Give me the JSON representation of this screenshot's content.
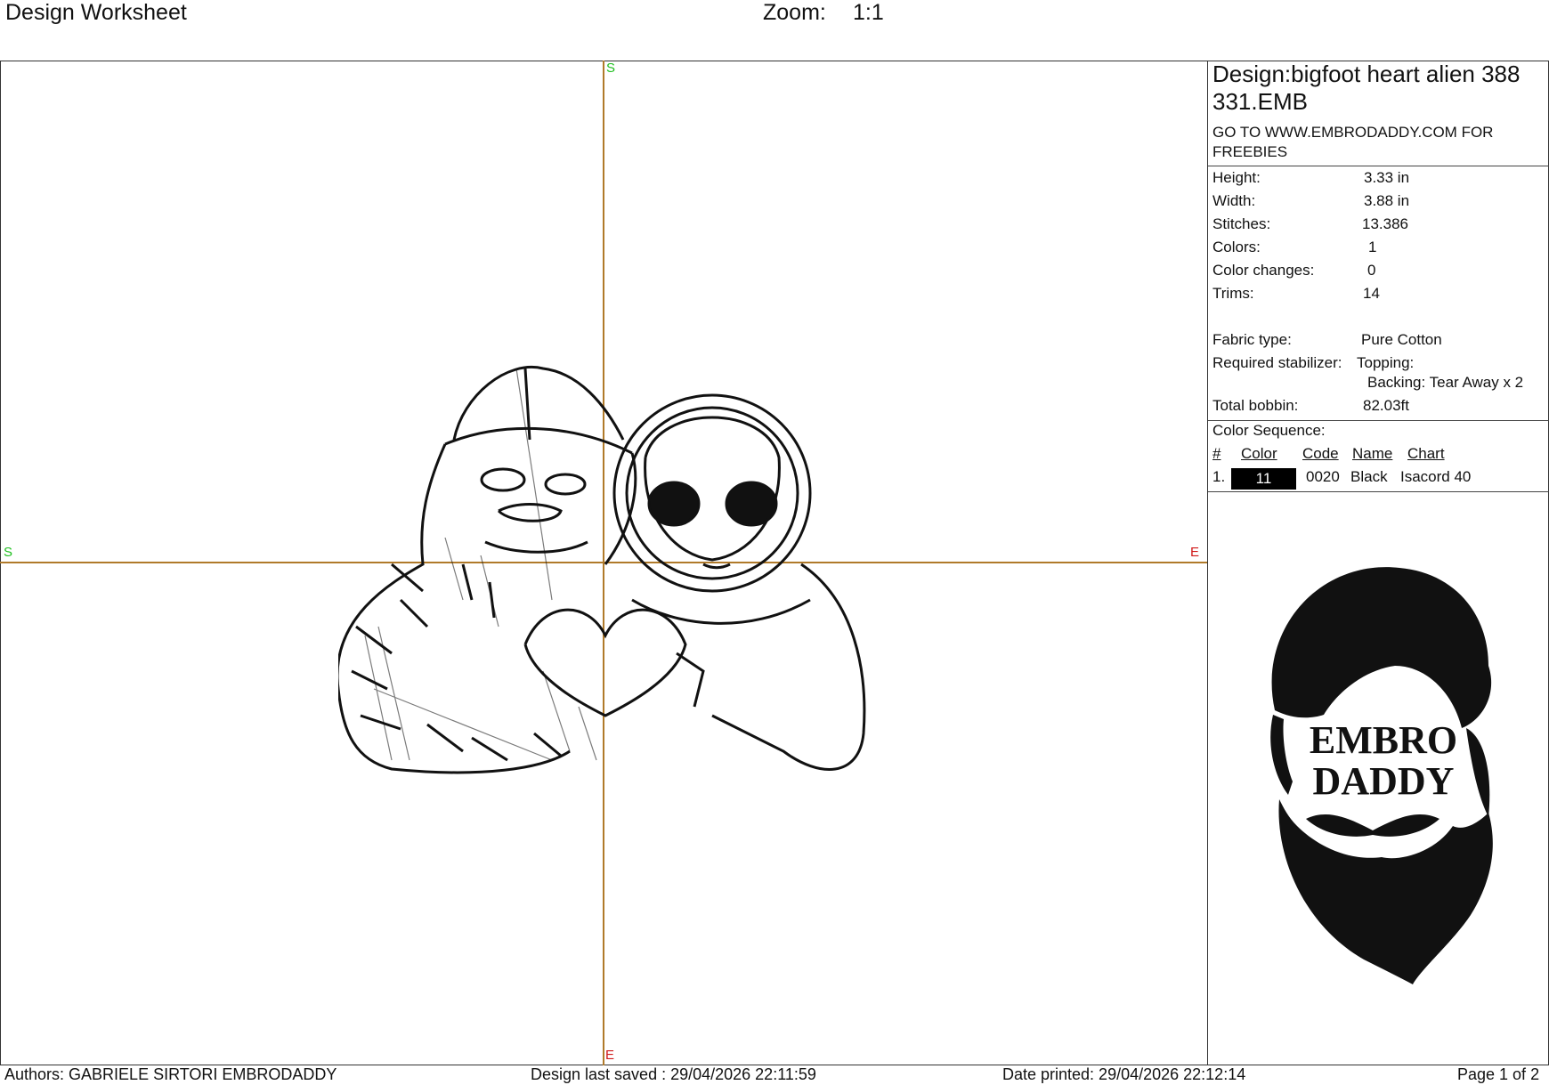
{
  "header": {
    "title": "Design Worksheet",
    "zoom_label": "Zoom:",
    "zoom_value": "1:1"
  },
  "canvas": {
    "markers": {
      "top": "S",
      "left": "S",
      "right": "E",
      "bottom": "E"
    },
    "colors": {
      "axis": "#b07a2a",
      "start_marker": "#20c020",
      "end_marker": "#d01818",
      "stitch": "#111111"
    }
  },
  "info": {
    "design_name": "Design:bigfoot heart alien 388 331.EMB",
    "promo": "GO TO WWW.EMBRODADDY.COM FOR FREEBIES",
    "height_label": "Height:",
    "height_value": "3.33 in",
    "width_label": "Width:",
    "width_value": "3.88 in",
    "stitches_label": "Stitches:",
    "stitches_value": "13.386",
    "colors_label": "Colors:",
    "colors_value": "1",
    "color_changes_label": "Color changes:",
    "color_changes_value": "0",
    "trims_label": "Trims:",
    "trims_value": "14",
    "fabric_label": "Fabric type:",
    "fabric_value": "Pure Cotton",
    "stabilizer_label": "Required stabilizer:",
    "topping_value": "Topping:",
    "backing_value": "Backing: Tear Away x 2",
    "bobbin_label": "Total bobbin:",
    "bobbin_value": "82.03ft"
  },
  "sequence": {
    "title": "Color Sequence:",
    "headers": {
      "num": "#",
      "color": "Color",
      "code": "Code",
      "name": "Name",
      "chart": "Chart"
    },
    "rows": [
      {
        "num": "1.",
        "color": "11",
        "code": "0020",
        "name": "Black",
        "chart": "Isacord 40",
        "swatch": "#000000"
      }
    ]
  },
  "logo": {
    "line1": "EMBRO",
    "line2": "DADDY",
    "icon": "bearded-man-logo"
  },
  "footer": {
    "authors": "Authors: GABRIELE SIRTORI EMBRODADDY",
    "saved": "Design last saved : 29/04/2026 22:11:59",
    "printed": "Date printed: 29/04/2026 22:12:14",
    "page": "Page 1 of 2"
  }
}
